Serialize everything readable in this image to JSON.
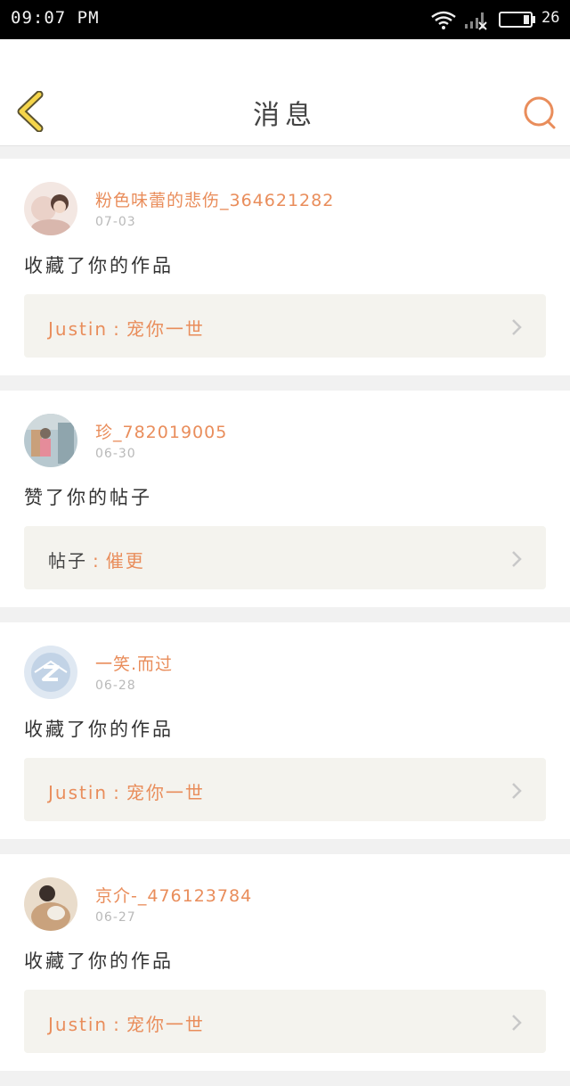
{
  "status_bar": {
    "time": "09:07 PM",
    "battery_level": "26"
  },
  "nav": {
    "title": "消息",
    "back_icon": "chevron-left-icon",
    "search_icon": "search-icon"
  },
  "colors": {
    "accent": "#e98d5b",
    "back_icon": "#f5d54a",
    "ref_bg": "#f4f3ee"
  },
  "messages": [
    {
      "username": "粉色味蕾的悲伤_364621282",
      "date": "07-03",
      "action": "收藏了你的作品",
      "ref_prefix": "Justin",
      "ref_sep": ":",
      "ref_title": "宠你一世",
      "prefix_accent": true,
      "avatar_colors": [
        "#f3e7e2",
        "#d9b7ad"
      ]
    },
    {
      "username": "珍_782019005",
      "date": "06-30",
      "action": "赞了你的帖子",
      "ref_prefix": "帖子",
      "ref_sep": ":",
      "ref_title": "催更",
      "prefix_accent": false,
      "avatar_colors": [
        "#b7c8cf",
        "#7a6b5f"
      ]
    },
    {
      "username": "一笑.而过",
      "date": "06-28",
      "action": "收藏了你的作品",
      "ref_prefix": "Justin",
      "ref_sep": ":",
      "ref_title": "宠你一世",
      "prefix_accent": true,
      "avatar_colors": [
        "#dfe8f2",
        "#c2d3e6"
      ]
    },
    {
      "username": "京介-_476123784",
      "date": "06-27",
      "action": "收藏了你的作品",
      "ref_prefix": "Justin",
      "ref_sep": ":",
      "ref_title": "宠你一世",
      "prefix_accent": true,
      "avatar_colors": [
        "#e9dccb",
        "#6b5547"
      ]
    }
  ]
}
